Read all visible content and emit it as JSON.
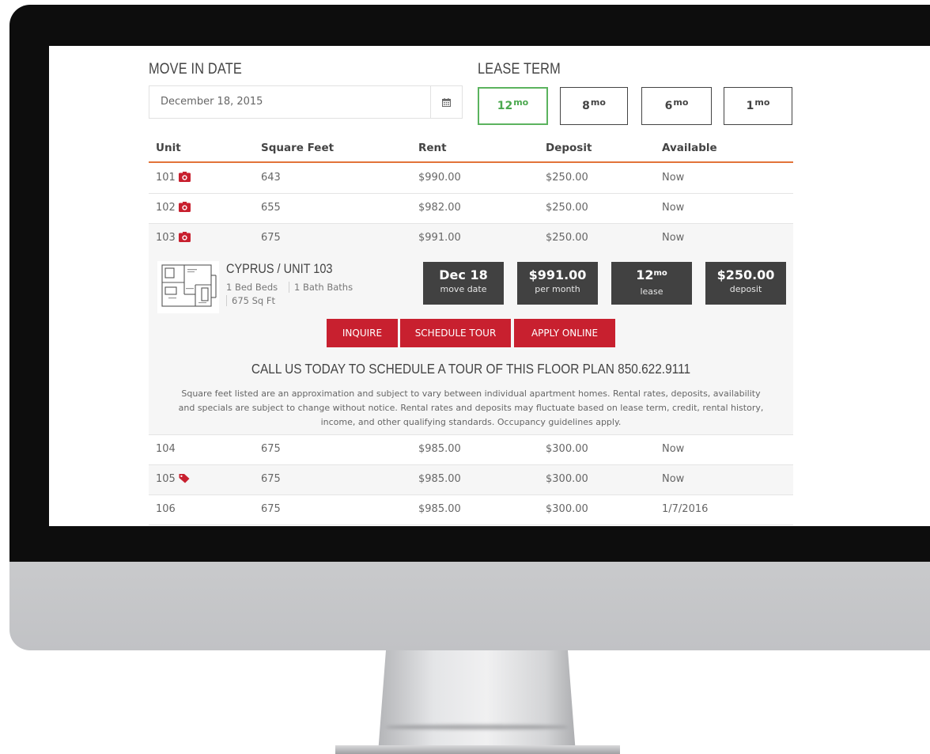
{
  "move_in": {
    "heading": "MOVE IN DATE",
    "date_value": "December 18, 2015"
  },
  "lease_term": {
    "heading": "LEASE TERM",
    "options": [
      {
        "value": "12",
        "unit": "mo",
        "selected": true
      },
      {
        "value": "8",
        "unit": "mo",
        "selected": false
      },
      {
        "value": "6",
        "unit": "mo",
        "selected": false
      },
      {
        "value": "1",
        "unit": "mo",
        "selected": false
      }
    ]
  },
  "table": {
    "headers": [
      "Unit",
      "Square Feet",
      "Rent",
      "Deposit",
      "Available"
    ],
    "rows": [
      {
        "unit": "101",
        "icon": "camera-icon",
        "sqft": "643",
        "rent": "$990.00",
        "deposit": "$250.00",
        "available": "Now"
      },
      {
        "unit": "102",
        "icon": "camera-icon",
        "sqft": "655",
        "rent": "$982.00",
        "deposit": "$250.00",
        "available": "Now"
      },
      {
        "unit": "103",
        "icon": "camera-icon",
        "sqft": "675",
        "rent": "$991.00",
        "deposit": "$250.00",
        "available": "Now"
      },
      {
        "unit": "104",
        "icon": "",
        "sqft": "675",
        "rent": "$985.00",
        "deposit": "$300.00",
        "available": "Now"
      },
      {
        "unit": "105",
        "icon": "tag-icon",
        "sqft": "675",
        "rent": "$985.00",
        "deposit": "$300.00",
        "available": "Now"
      },
      {
        "unit": "106",
        "icon": "",
        "sqft": "675",
        "rent": "$985.00",
        "deposit": "$300.00",
        "available": "1/7/2016"
      }
    ]
  },
  "detail": {
    "title": "CYPRUS / UNIT 103",
    "beds": "1 Bed Beds",
    "baths": "1 Bath Baths",
    "sqft": "675 Sq Ft",
    "stats": {
      "move_date": {
        "value": "Dec 18",
        "label": "move date"
      },
      "rent": {
        "value": "$991.00",
        "label": "per month"
      },
      "lease": {
        "value": "12",
        "unit": "mo",
        "label": "lease"
      },
      "deposit": {
        "value": "$250.00",
        "label": "deposit"
      }
    },
    "actions": {
      "inquire": "INQUIRE",
      "schedule": "SCHEDULE TOUR",
      "apply": "APPLY ONLINE"
    },
    "cta": "CALL US TODAY TO SCHEDULE A TOUR OF THIS FLOOR PLAN 850.622.9111",
    "disclaimer_lines": [
      "Square feet listed are an approximation and subject to vary between individual apartment homes. Rental rates, deposits, availability",
      "and specials are subject to change without notice. Rental rates and deposits may fluctuate based on lease term, credit, rental history,",
      "income, and other qualifying standards. Occupancy guidelines apply."
    ]
  },
  "colors": {
    "accent_red": "#c8202f",
    "selected_green": "#4aa84e",
    "header_underline": "#e27339",
    "stat_box": "#414141"
  }
}
